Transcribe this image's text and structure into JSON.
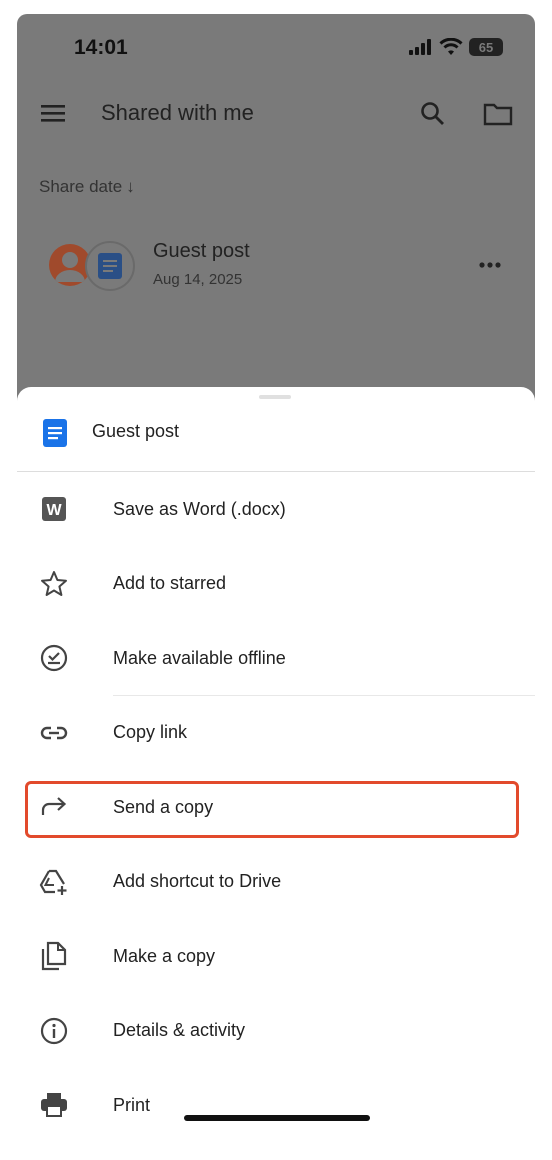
{
  "status_bar": {
    "time": "14:01",
    "battery": "65"
  },
  "app_bar": {
    "title": "Shared with me"
  },
  "sort": {
    "label": "Share date",
    "arrow": "↓"
  },
  "file": {
    "name": "Guest post",
    "date": "Aug 14, 2025"
  },
  "sheet": {
    "title": "Guest post",
    "items": [
      {
        "label": "Save as Word (.docx)",
        "icon": "word-icon"
      },
      {
        "label": "Add to starred",
        "icon": "star-icon"
      },
      {
        "label": "Make available offline",
        "icon": "offline-icon"
      },
      {
        "label": "Copy link",
        "icon": "link-icon"
      },
      {
        "label": "Send a copy",
        "icon": "share-arrow-icon"
      },
      {
        "label": "Add shortcut to Drive",
        "icon": "drive-shortcut-icon"
      },
      {
        "label": "Make a copy",
        "icon": "copy-icon"
      },
      {
        "label": "Details & activity",
        "icon": "info-icon"
      },
      {
        "label": "Print",
        "icon": "print-icon"
      }
    ]
  },
  "colors": {
    "highlight": "#e24a2c",
    "docs_blue": "#1a73e8",
    "dim_overlay": "#7a7a7a"
  }
}
